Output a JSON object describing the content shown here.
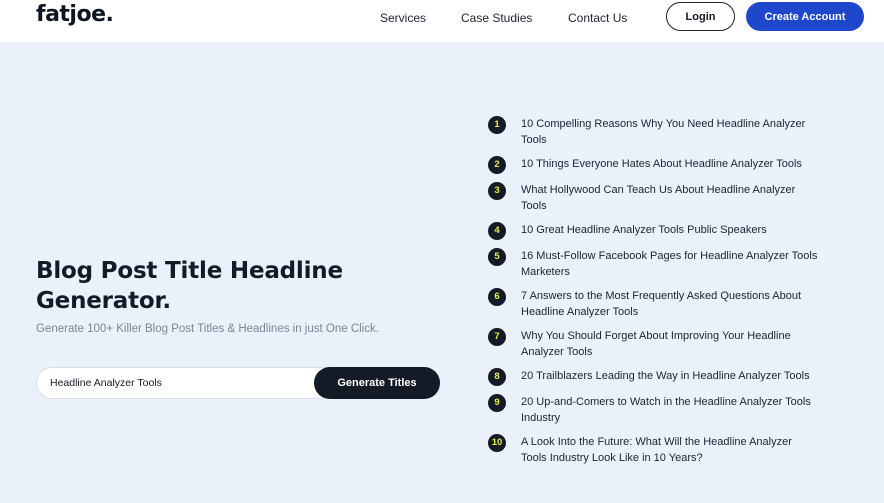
{
  "header": {
    "logo": "fatjoe.",
    "nav": [
      "Services",
      "Case Studies",
      "Contact Us"
    ],
    "login_label": "Login",
    "create_label": "Create Account"
  },
  "hero": {
    "title": "Blog Post Title Headline Generator.",
    "subtitle": "Generate 100+ Killer Blog Post Titles & Headlines in just One Click.",
    "search_value": "Headline Analyzer Tools",
    "generate_label": "Generate Titles"
  },
  "titles": [
    {
      "num": "1",
      "text": "10 Compelling Reasons Why You Need Headline Analyzer Tools"
    },
    {
      "num": "2",
      "text": "10 Things Everyone Hates About Headline Analyzer Tools"
    },
    {
      "num": "3",
      "text": "What Hollywood Can Teach Us About Headline Analyzer Tools"
    },
    {
      "num": "4",
      "text": "10 Great Headline Analyzer Tools Public Speakers"
    },
    {
      "num": "5",
      "text": "16 Must-Follow Facebook Pages for Headline Analyzer Tools Marketers"
    },
    {
      "num": "6",
      "text": "7 Answers to the Most Frequently Asked Questions About Headline Analyzer Tools"
    },
    {
      "num": "7",
      "text": "Why You Should Forget About Improving Your Headline Analyzer Tools"
    },
    {
      "num": "8",
      "text": "20 Trailblazers Leading the Way in Headline Analyzer Tools"
    },
    {
      "num": "9",
      "text": "20 Up-and-Comers to Watch in the Headline Analyzer Tools Industry"
    },
    {
      "num": "10",
      "text": "A Look Into the Future: What Will the Headline Analyzer Tools Industry Look Like in 10 Years?"
    }
  ],
  "colors": {
    "accent": "#1f47cc",
    "dark": "#141a26",
    "number_text": "#e8f04a",
    "background": "#eaf1fb"
  }
}
